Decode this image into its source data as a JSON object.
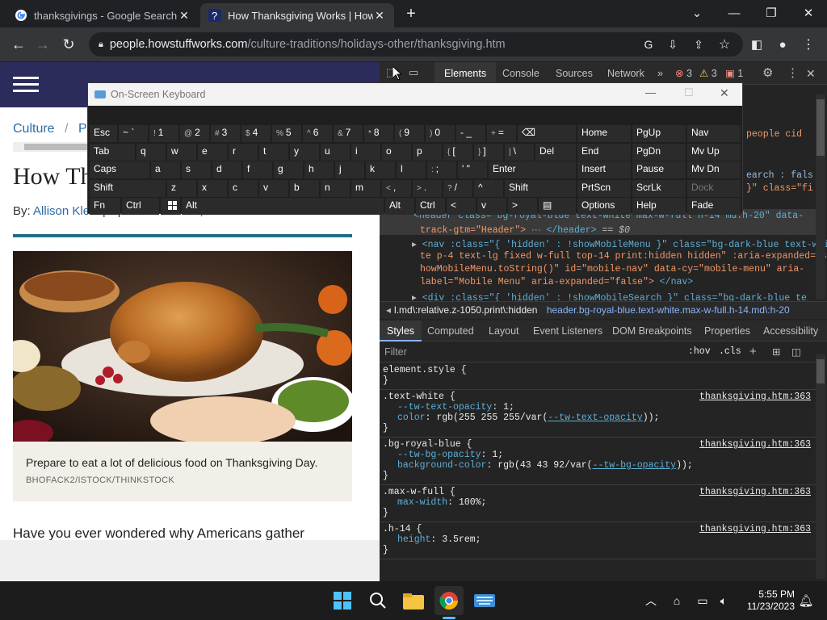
{
  "browser": {
    "tabs": [
      {
        "title": "thanksgivings - Google Search",
        "icon": "google-icon"
      },
      {
        "title": "How Thanksgiving Works | HowS",
        "icon": "howstuffworks-icon"
      }
    ],
    "url_host": "people.howstuffworks.com",
    "url_path": "/culture-traditions/holidays-other/thanksgiving.htm"
  },
  "page": {
    "breadcrumb_1": "Culture",
    "breadcrumb_sep": "/",
    "breadcrumb_2": "P",
    "title": "How Th",
    "byline_prefix": "By:",
    "author": "Allison Klein",
    "updated": "| Updated: Nov 22, 2023",
    "caption": "Prepare to eat a lot of delicious food on Thanksgiving Day.",
    "credit": "BHOFACK2/ISTOCK/THINKSTOCK",
    "intro": "Have you ever wondered why Americans gather"
  },
  "devtools": {
    "tabs": [
      "Elements",
      "Console",
      "Sources",
      "Network"
    ],
    "error_count": "3",
    "warning_count": "3",
    "issue_count": "1",
    "html_fragments": {
      "people_cid": "people  cid",
      "search_false": "earch : fals",
      "class_fi": "}\" class=\"fi",
      "header_line1": "<header class=\"bg-royal-blue text-white max-w-full h-14 md:h-20\" data-",
      "header_line2": "track-gtm=\"Header\">",
      "header_close": "</header>",
      "header_eq": "== $0",
      "nav_line1": "<nav :class=\"{ 'hidden' : !showMobileMenu }\" class=\"bg-dark-blue text-whi",
      "nav_line2": "te p-4 text-lg fixed w-full top-14 print:hidden hidden\" :aria-expanded=\"s",
      "nav_line3": "howMobileMenu.toString()\" id=\"mobile-nav\" data-cy=\"mobile-menu\" aria-",
      "nav_line4": "label=\"Mobile Menu\" aria-expanded=\"false\">",
      "nav_close": "</nav>",
      "div_line": "<div :class=\"{ 'hidden' : !showMobileSearch }\" class=\"bg-dark-blue text-w"
    },
    "crumb_1": "l.md\\:relative.z-1050.print\\:hidden",
    "crumb_2": "header.bg-royal-blue.text-white.max-w-full.h-14.md\\:h-20",
    "style_tabs": [
      "Styles",
      "Computed",
      "Layout",
      "Event Listeners",
      "DOM Breakpoints",
      "Properties",
      "Accessibility"
    ],
    "filter_placeholder": "Filter",
    "hov": ":hov",
    "cls": ".cls",
    "rules": [
      {
        "selector": "element.style {",
        "source": "",
        "props": []
      },
      {
        "selector": ".text-white {",
        "source": "thanksgiving.htm:363",
        "props": [
          {
            "name": "--tw-text-opacity",
            "value": "1;"
          },
          {
            "name": "color",
            "value": "rgb(255 255 255/var(",
            "var": "--tw-text-opacity",
            "tail": "));"
          }
        ]
      },
      {
        "selector": ".bg-royal-blue {",
        "source": "thanksgiving.htm:363",
        "props": [
          {
            "name": "--tw-bg-opacity",
            "value": "1;"
          },
          {
            "name": "background-color",
            "value": "rgb(43 43 92/var(",
            "var": "--tw-bg-opacity",
            "tail": "));"
          }
        ]
      },
      {
        "selector": ".max-w-full {",
        "source": "thanksgiving.htm:363",
        "props": [
          {
            "name": "max-width",
            "value": "100%;"
          }
        ]
      },
      {
        "selector": ".h-14 {",
        "source": "thanksgiving.htm:363",
        "props": [
          {
            "name": "height",
            "value": "3.5rem;"
          }
        ]
      }
    ],
    "close_brace": "}"
  },
  "osk": {
    "title": "On-Screen Keyboard",
    "keys": {
      "esc": "Esc",
      "tilde": "~ `",
      "k1": "1",
      "k1s": "!",
      "k2": "2",
      "k2s": "@",
      "k3": "3",
      "k3s": "#",
      "k4": "4",
      "k4s": "$",
      "k5": "5",
      "k5s": "%",
      "k6": "6",
      "k6s": "^",
      "k7": "7",
      "k7s": "&",
      "k8": "8",
      "k8s": "*",
      "k9": "9",
      "k9s": "(",
      "k0": "0",
      "k0s": ")",
      "minus": "- _",
      "plus": "=",
      "pluss": "+",
      "bksp": "⌫",
      "tab": "Tab",
      "q": "q",
      "w": "w",
      "e": "e",
      "r": "r",
      "t": "t",
      "y": "y",
      "u": "u",
      "i": "i",
      "o": "o",
      "p": "p",
      "lbr": "[",
      "lbrs": "{",
      "rbr": "]",
      "rbrs": "}",
      "bsl": "\\",
      "bsls": "|",
      "del": "Del",
      "caps": "Caps",
      "a": "a",
      "s": "s",
      "d": "d",
      "f": "f",
      "g": "g",
      "h": "h",
      "j": "j",
      "k": "k",
      "l": "l",
      "semi": ";",
      "semis": ":",
      "quote": "' \"",
      "enter": "Enter",
      "shift": "Shift",
      "z": "z",
      "x": "x",
      "c": "c",
      "v": "v",
      "b": "b",
      "n": "n",
      "m": "m",
      "comma": ",",
      "commas": "<",
      "period": ".",
      "periods": ">",
      "slash": "/",
      "slashs": "?",
      "up": "^",
      "rshift": "Shift",
      "fn": "Fn",
      "ctrl": "Ctrl",
      "alt": "Alt",
      "ralt": "Alt",
      "rctrl": "Ctrl",
      "left": "<",
      "down": "v",
      "right": ">",
      "menu": "▤",
      "home": "Home",
      "pgup": "PgUp",
      "nav": "Nav",
      "end": "End",
      "pgdn": "PgDn",
      "mvup": "Mv Up",
      "insert": "Insert",
      "pause": "Pause",
      "mvdn": "Mv Dn",
      "prtscn": "PrtScn",
      "scrlk": "ScrLk",
      "dock": "Dock",
      "options": "Options",
      "help": "Help",
      "fade": "Fade"
    }
  },
  "taskbar": {
    "time": "5:55 PM",
    "date": "11/23/2023"
  },
  "colors": {
    "brand_blue": "#2b2b5c",
    "devtools_bg": "#242424",
    "link": "#2c6aa6"
  }
}
